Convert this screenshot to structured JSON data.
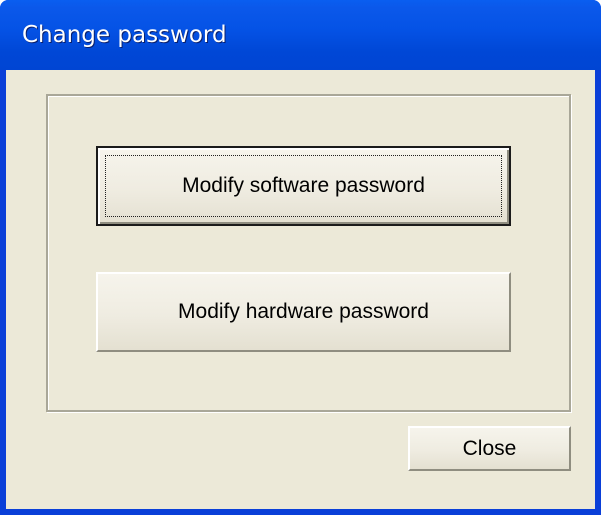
{
  "window": {
    "title": "Change password"
  },
  "buttons": {
    "modify_software": "Modify software password",
    "modify_hardware": "Modify hardware password",
    "close": "Close"
  },
  "colors": {
    "titlebar": "#0553e6",
    "face": "#ece9d8",
    "title_text": "#ffffff"
  }
}
